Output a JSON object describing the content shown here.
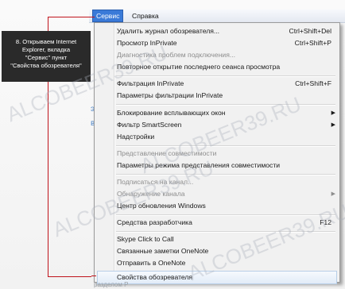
{
  "menubar": {
    "items": [
      "Сервис",
      "Справка"
    ]
  },
  "background": {
    "text_1": "э",
    "text_2": "ва",
    "caption": "разделом Р"
  },
  "callout": {
    "lines": [
      "8.  Открываем Internet",
      "Explorer, вкладка",
      "\"Сервис\"  пункт",
      "\"Свойства обозревателя\""
    ]
  },
  "watermark": "ALCOBEER39.RU",
  "menu": {
    "items": [
      {
        "label": "Удалить журнал обозревателя...",
        "shortcut": "Ctrl+Shift+Del",
        "enabled": true
      },
      {
        "label": "Просмотр InPrivate",
        "shortcut": "Ctrl+Shift+P",
        "enabled": true
      },
      {
        "label": "Диагностика проблем подключения...",
        "shortcut": "",
        "enabled": false
      },
      {
        "label": "Повторное открытие последнего сеанса просмотра",
        "shortcut": "",
        "enabled": true
      },
      {
        "label": "Фильтрация InPrivate",
        "shortcut": "Ctrl+Shift+F",
        "enabled": true
      },
      {
        "label": "Параметры фильтрации InPrivate",
        "shortcut": "",
        "enabled": true
      },
      {
        "label": "Блокирование всплывающих окон",
        "shortcut": "",
        "enabled": true,
        "submenu": true
      },
      {
        "label": "Фильтр SmartScreen",
        "shortcut": "",
        "enabled": true,
        "submenu": true
      },
      {
        "label": "Надстройки",
        "shortcut": "",
        "enabled": true
      },
      {
        "label": "Представление совместимости",
        "shortcut": "",
        "enabled": false
      },
      {
        "label": "Параметры режима представления совместимости",
        "shortcut": "",
        "enabled": true
      },
      {
        "label": "Подписаться на канал...",
        "shortcut": "",
        "enabled": false
      },
      {
        "label": "Обнаружение канала",
        "shortcut": "",
        "enabled": false,
        "submenu": true
      },
      {
        "label": "Центр обновления Windows",
        "shortcut": "",
        "enabled": true
      },
      {
        "label": "Средства разработчика",
        "shortcut": "F12",
        "enabled": true
      },
      {
        "label": "Skype Click to Call",
        "shortcut": "",
        "enabled": true
      },
      {
        "label": "Связанные заметки OneNote",
        "shortcut": "",
        "enabled": true
      },
      {
        "label": "Отправить в OneNote",
        "shortcut": "",
        "enabled": true
      },
      {
        "label": "Свойства обозревателя",
        "shortcut": "",
        "enabled": true,
        "highlighted": true
      }
    ]
  },
  "icons": {
    "submenu_arrow": "arrow-right-icon"
  },
  "colors": {
    "highlight_red": "#c0141c",
    "menu_selected": "#3a7ad8",
    "callout_bg": "#2a2a2a"
  }
}
